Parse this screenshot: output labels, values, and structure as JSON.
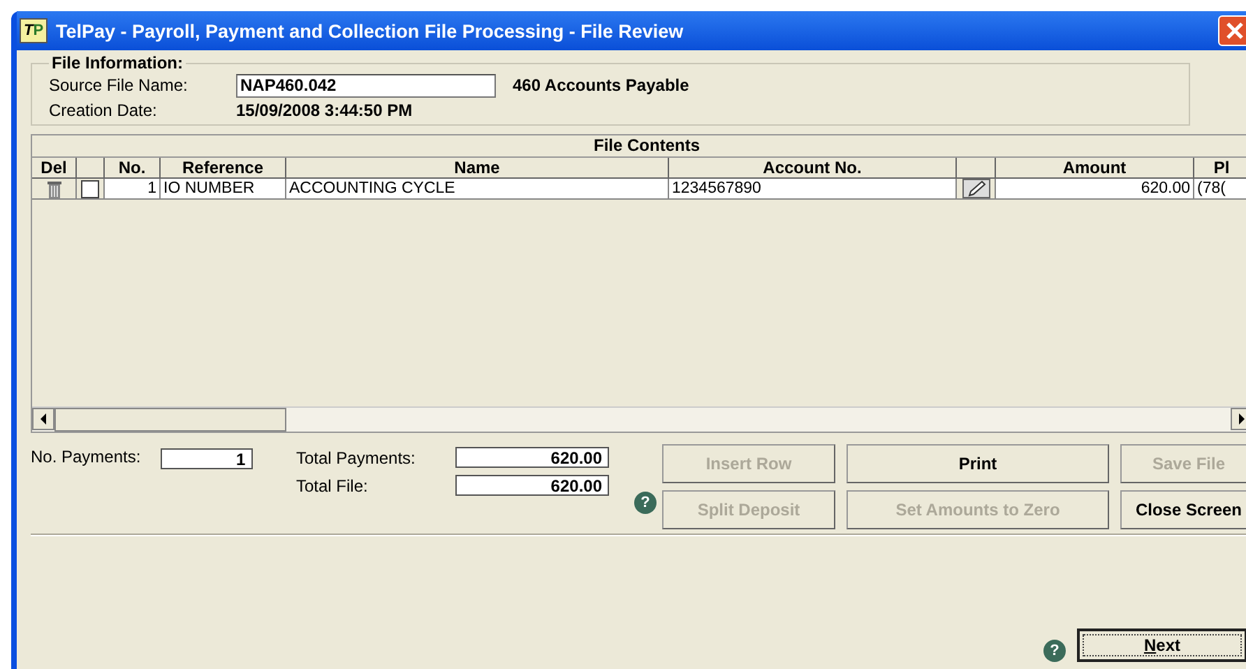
{
  "window": {
    "title": "TelPay - Payroll, Payment and Collection File Processing - File Review"
  },
  "file_information": {
    "legend": "File Information:",
    "source_label": "Source File Name:",
    "source_value": "NAP460.042",
    "source_description": "460 Accounts Payable",
    "date_label": "Creation Date:",
    "date_value": "15/09/2008 3:44:50 PM"
  },
  "table": {
    "title": "File Contents",
    "columns": [
      "Del",
      "",
      "No.",
      "Reference",
      "Name",
      "Account No.",
      "",
      "Amount",
      "Pl"
    ],
    "rows": [
      {
        "checked": false,
        "no": "1",
        "reference": "IO NUMBER",
        "name": "ACCOUNTING CYCLE",
        "account": "1234567890",
        "amount": "620.00",
        "column_9": "(78("
      }
    ]
  },
  "totals": {
    "payments_label": "No. Payments:",
    "payments_value": "1",
    "total_payments_label": "Total Payments:",
    "total_payments_value": "620.00",
    "total_file_label": "Total File:",
    "total_file_value": "620.00"
  },
  "buttons": [
    {
      "label": "Insert Row",
      "disabled": true
    },
    {
      "label": "Print",
      "disabled": false
    },
    {
      "label": "Save File",
      "disabled": true
    },
    {
      "label": "Split Deposit",
      "disabled": true
    },
    {
      "label": "Set Amounts to Zero",
      "disabled": true
    },
    {
      "label": "Close Screen",
      "disabled": false
    }
  ],
  "next_button": {
    "label": "Next"
  },
  "logo": {
    "letters": [
      "T",
      "P"
    ]
  },
  "help_icons": [
    "?",
    "?"
  ]
}
